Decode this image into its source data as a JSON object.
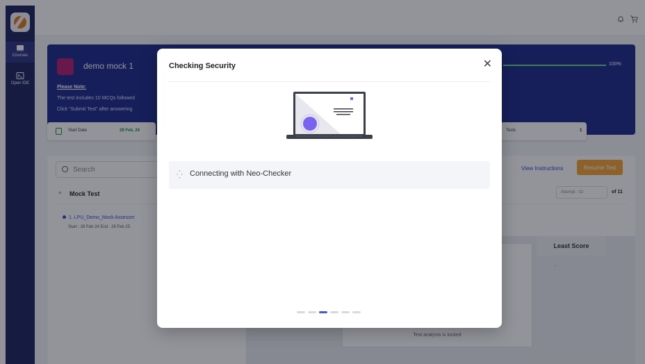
{
  "sidebar": {
    "items": [
      {
        "label": "Courses",
        "icon": "book-icon"
      },
      {
        "label": "Open IDE",
        "icon": "terminal-icon"
      }
    ]
  },
  "topbar": {
    "icons": [
      "bell-icon",
      "cart-icon"
    ]
  },
  "banner": {
    "title": "demo mock 1",
    "note_heading": "Please Note:",
    "note_line1": "The test includes 10 MCQs followed",
    "note_line2": "Click \"Submit Test\" after answering",
    "progress_label": "100%",
    "start_date_label": "Start Date",
    "start_date_value": "28 Feb, 24",
    "tests_label": "Tests",
    "tests_value": "1"
  },
  "panel": {
    "search_placeholder": "Search",
    "view_instructions": "View Instructions",
    "resume_button": "Resume Test",
    "section_title": "Mock Test",
    "attempt_label": "Attempt : 02",
    "of_label": "of 11",
    "item_title": "1. LPU_Demo_Mock Assessm",
    "item_dates": "Start : 28 Feb 24   End : 28 Feb 25",
    "least_score_header": "Least Score",
    "least_score_value": "-",
    "analysis_locked": "Test analysis is locked"
  },
  "modal": {
    "title": "Checking Security",
    "status": "Connecting with Neo-Checker",
    "step_current": 3,
    "step_total": 6
  },
  "colors": {
    "sidebar": "#1c2360",
    "banner": "#1d2b8a",
    "accent": "#3d5bf0",
    "resume": "#f2a233"
  }
}
